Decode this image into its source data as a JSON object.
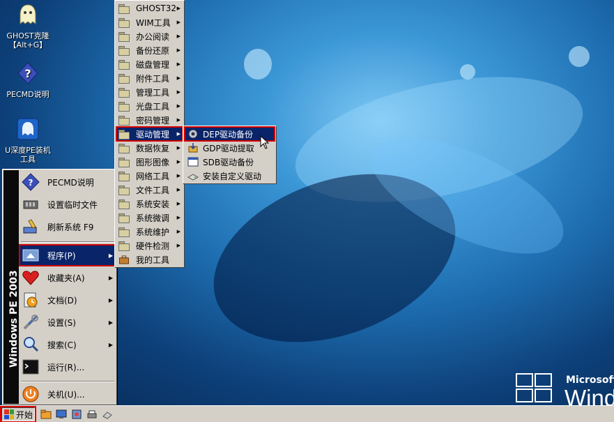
{
  "desktop": {
    "icons": [
      {
        "label_line1": "GHOST克隆",
        "label_line2": "【Alt+G】",
        "icon": "ghost-icon"
      },
      {
        "label_line1": "PECMD说明",
        "label_line2": "",
        "icon": "help-icon"
      },
      {
        "label_line1": "U深度PE装机",
        "label_line2": "工具",
        "icon": "installer-icon"
      }
    ],
    "brand_top": "Microsoft®",
    "brand_bottom": "Wind"
  },
  "start_menu": {
    "side_band": "Windows PE 2003",
    "items": [
      {
        "label": "PECMD说明",
        "icon": "help-icon"
      },
      {
        "label": "设置临时文件",
        "icon": "memory-chip-icon"
      },
      {
        "label": "刷新系统 F9",
        "icon": "refresh-broom-icon"
      },
      {
        "label": "程序(P)",
        "icon": "programs-icon",
        "selected": true
      },
      {
        "label": "收藏夹(A)",
        "icon": "favorites-heart-icon"
      },
      {
        "label": "文档(D)",
        "icon": "documents-icon"
      },
      {
        "label": "设置(S)",
        "icon": "settings-tools-icon"
      },
      {
        "label": "搜索(C)",
        "icon": "search-icon"
      },
      {
        "label": "运行(R)...",
        "icon": "run-terminal-icon"
      },
      {
        "label": "关机(U)...",
        "icon": "shutdown-icon"
      }
    ]
  },
  "programs_menu": {
    "items": [
      {
        "label": "GHOST32"
      },
      {
        "label": "WIM工具"
      },
      {
        "label": "办公阅读"
      },
      {
        "label": "备份还原"
      },
      {
        "label": "磁盘管理"
      },
      {
        "label": "附件工具"
      },
      {
        "label": "管理工具"
      },
      {
        "label": "光盘工具"
      },
      {
        "label": "密码管理"
      },
      {
        "label": "驱动管理",
        "selected": true
      },
      {
        "label": "数据恢复"
      },
      {
        "label": "图形图像"
      },
      {
        "label": "网络工具"
      },
      {
        "label": "文件工具"
      },
      {
        "label": "系统安装"
      },
      {
        "label": "系统微调"
      },
      {
        "label": "系统维护"
      },
      {
        "label": "硬件检测"
      },
      {
        "label": "我的工具"
      }
    ]
  },
  "driver_menu": {
    "items": [
      {
        "label": "DEP驱动备份",
        "icon": "gear-disc-icon",
        "selected": true
      },
      {
        "label": "GDP驱动提取",
        "icon": "extract-icon"
      },
      {
        "label": "SDB驱动备份",
        "icon": "window-backup-icon"
      },
      {
        "label": "安装自定义驱动",
        "icon": "drive-install-icon"
      }
    ]
  },
  "taskbar": {
    "start_label": "开始"
  },
  "colors": {
    "menu_bg": "#d4d0c8",
    "highlight": "#0a246a",
    "highlight_border": "#d40000"
  }
}
